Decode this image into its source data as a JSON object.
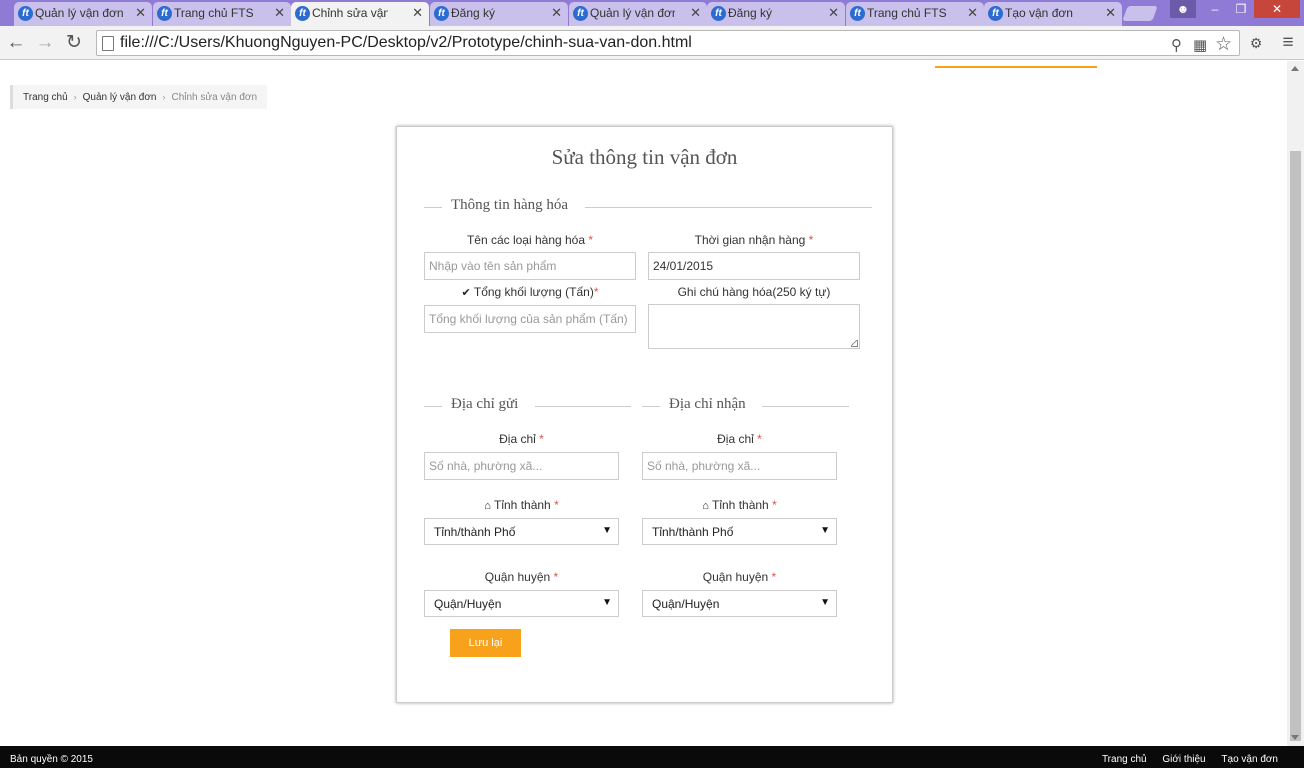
{
  "browser": {
    "tabs": [
      {
        "title": "Quản lý vận đơn",
        "active": false
      },
      {
        "title": "Trang chủ FTS",
        "active": false
      },
      {
        "title": "Chỉnh sửa vận đơn",
        "active": true
      },
      {
        "title": "Đăng ký",
        "active": false
      },
      {
        "title": "Quản lý vận đơn",
        "active": false
      },
      {
        "title": "Đăng ký",
        "active": false
      },
      {
        "title": "Trang chủ FTS",
        "active": false
      },
      {
        "title": "Tạo vận đơn",
        "active": false
      }
    ],
    "url": "file:///C:/Users/KhuongNguyen-PC/Desktop/v2/Prototype/chinh-sua-van-don.html"
  },
  "breadcrumb": {
    "home": "Trang chủ",
    "list": "Quản lý vận đơn",
    "current": "Chỉnh sửa vận đơn"
  },
  "form": {
    "title": "Sửa thông tin vận đơn",
    "goods_section": "Thông tin hàng hóa",
    "goods_name_label": "Tên các loại hàng hóa",
    "goods_name_placeholder": "Nhập vào tên sản phẩm",
    "receive_time_label": "Thời gian nhận hàng",
    "receive_time_value": "24/01/2015",
    "weight_label": "Tổng khối lượng (Tấn)",
    "weight_placeholder": "Tổng khối lượng của sản phẩm (Tấn)",
    "note_label": "Ghi chú hàng hóa(250 ký tự)",
    "note_value": "",
    "sender_section": "Địa chỉ gửi",
    "receiver_section": "Địa chỉ nhận",
    "address_label": "Địa chỉ",
    "address_placeholder": "Số nhà, phường xã...",
    "province_label": "Tỉnh thành",
    "province_selected": "Tỉnh/thành Phố",
    "district_label": "Quận huyện",
    "district_selected": "Quận/Huyện",
    "required_mark": "*",
    "save_label": "Lưu lại"
  },
  "footer": {
    "copyright": "Bản quyền © 2015",
    "links": [
      "Trang chủ",
      "Giới thiệu",
      "Tạo vận đơn"
    ]
  },
  "colors": {
    "accent": "#f7a21a",
    "required": "#d9534f",
    "tabstrip": "#8f7ad6"
  }
}
